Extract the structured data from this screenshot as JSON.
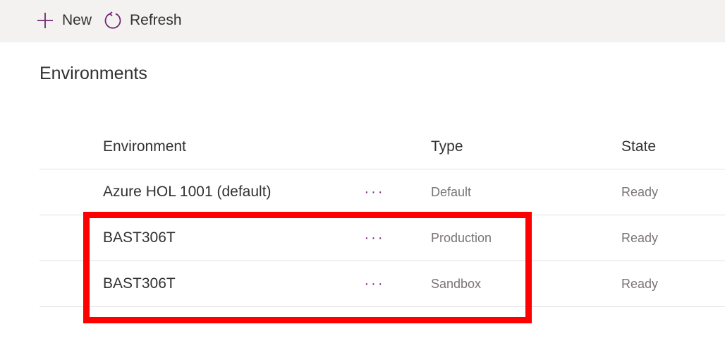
{
  "toolbar": {
    "new_label": "New",
    "refresh_label": "Refresh",
    "new_icon": "plus-icon",
    "refresh_icon": "refresh-icon",
    "icon_color": "#742774"
  },
  "page": {
    "title": "Environments"
  },
  "table": {
    "columns": {
      "environment": "Environment",
      "type": "Type",
      "state": "State"
    },
    "rows": [
      {
        "environment": "Azure HOL 1001 (default)",
        "more": "···",
        "type": "Default",
        "state": "Ready"
      },
      {
        "environment": "BAST306T",
        "more": "···",
        "type": "Production",
        "state": "Ready"
      },
      {
        "environment": "BAST306T",
        "more": "···",
        "type": "Sandbox",
        "state": "Ready"
      }
    ]
  },
  "annotation": {
    "color": "#ff0000"
  }
}
